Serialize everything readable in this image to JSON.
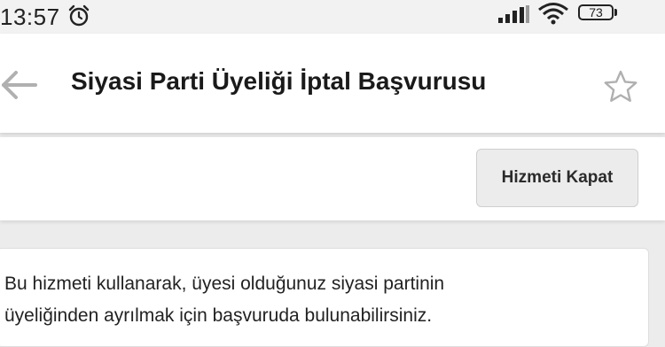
{
  "status_bar": {
    "time": "13:57",
    "battery_level": "73",
    "icons": [
      "alarm-icon",
      "signal-icon",
      "wifi-icon",
      "battery-icon"
    ]
  },
  "header": {
    "title": "Siyasi Parti Üyeliği İptal Başvurusu",
    "back_icon": "arrow-left-icon",
    "favorite_icon": "star-outline-icon"
  },
  "actions": {
    "close_service_label": "Hizmeti Kapat"
  },
  "info": {
    "line1": "Bu hizmeti kullanarak, üyesi olduğunuz siyasi partinin",
    "line2": "üyeliğinden ayrılmak için başvuruda bulunabilirsiniz."
  },
  "colors": {
    "background": "#ececec",
    "surface": "#ffffff",
    "text": "#1a1a1a",
    "button_bg": "#ececec",
    "icon_gray": "#b0b0b0"
  }
}
